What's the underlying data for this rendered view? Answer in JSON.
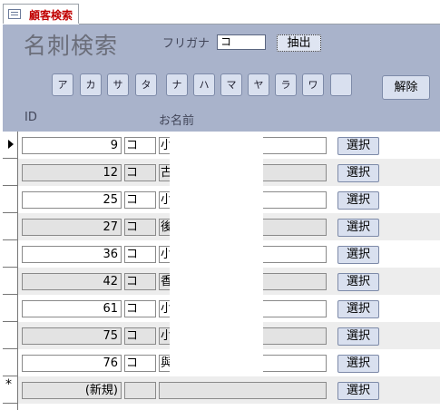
{
  "tab": {
    "title": "顧客検索",
    "icon": "form-icon"
  },
  "header": {
    "title": "名刺検索",
    "kana_label": "フリガナ",
    "kana_value": "コ",
    "extract_label": "抽出",
    "kana_buttons": [
      "ア",
      "カ",
      "サ",
      "タ",
      "ナ",
      "ハ",
      "マ",
      "ヤ",
      "ラ",
      "ワ",
      ""
    ],
    "clear_label": "解除",
    "col_id": "ID",
    "col_name": "お名前"
  },
  "rows": [
    {
      "id": "9",
      "kana": "コ",
      "name": "小",
      "select": "選択"
    },
    {
      "id": "12",
      "kana": "コ",
      "name": "古",
      "select": "選択"
    },
    {
      "id": "25",
      "kana": "コ",
      "name": "小",
      "select": "選択"
    },
    {
      "id": "27",
      "kana": "コ",
      "name": "後",
      "select": "選択"
    },
    {
      "id": "36",
      "kana": "コ",
      "name": "小",
      "select": "選択"
    },
    {
      "id": "42",
      "kana": "コ",
      "name": "香",
      "select": "選択"
    },
    {
      "id": "61",
      "kana": "コ",
      "name": "小",
      "select": "選択"
    },
    {
      "id": "75",
      "kana": "コ",
      "name": "小",
      "select": "選択"
    },
    {
      "id": "76",
      "kana": "コ",
      "name": "與",
      "select": "選択"
    }
  ],
  "new_row": {
    "id": "(新規)",
    "kana": "",
    "name": "",
    "select": "選択"
  },
  "colors": {
    "header_bg": "#a9b3cb",
    "button_bg": "#d9e0ef",
    "tab_title": "#c00000"
  }
}
